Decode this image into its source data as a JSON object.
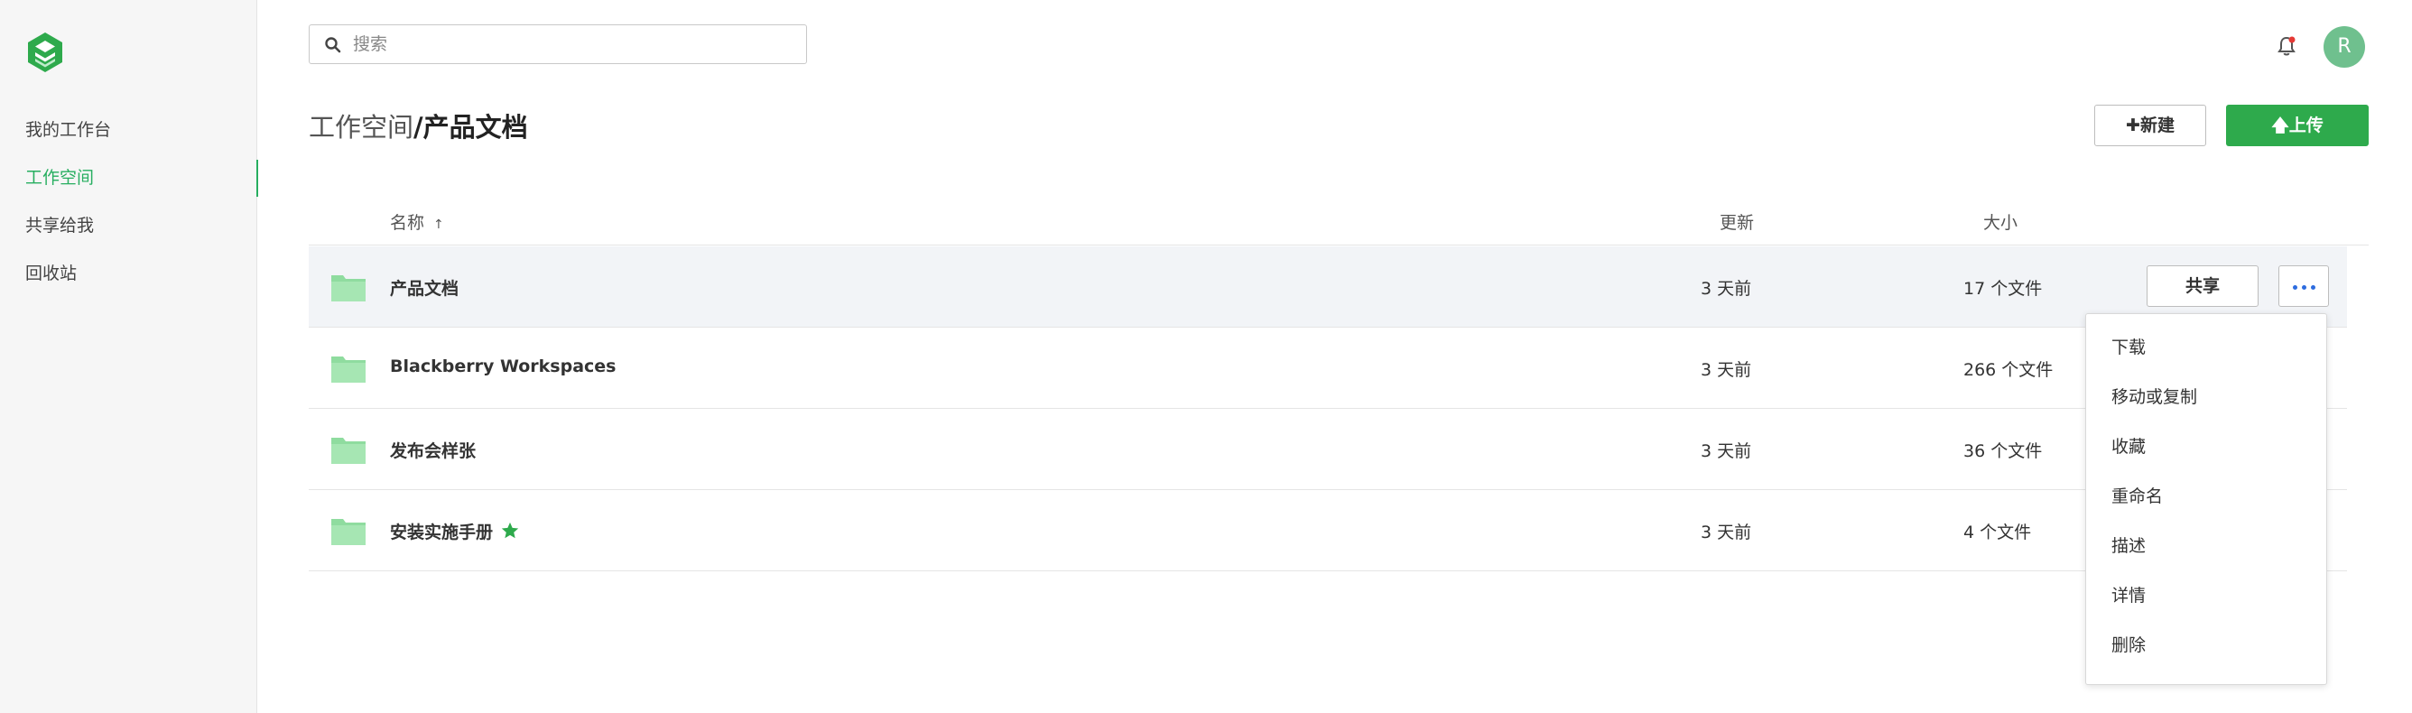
{
  "sidebar": {
    "items": [
      {
        "label": "我的工作台"
      },
      {
        "label": "工作空间"
      },
      {
        "label": "共享给我"
      },
      {
        "label": "回收站"
      }
    ]
  },
  "header": {
    "search_placeholder": "搜索",
    "avatar_initial": "R"
  },
  "page": {
    "breadcrumb_parent": "工作空间",
    "breadcrumb_sep": "/",
    "breadcrumb_current": "产品文档",
    "new_label": "新建",
    "upload_label": "上传"
  },
  "table": {
    "columns": {
      "name": "名称",
      "updated": "更新",
      "size": "大小"
    },
    "rows": [
      {
        "name": "产品文档",
        "updated": "3 天前",
        "size": "17 个文件"
      },
      {
        "name": "Blackberry Workspaces",
        "updated": "3 天前",
        "size": "266 个文件"
      },
      {
        "name": "发布会样张",
        "updated": "3 天前",
        "size": "36 个文件"
      },
      {
        "name": "安装实施手册",
        "updated": "3 天前",
        "size": "4 个文件",
        "starred": true
      }
    ],
    "share_label": "共享"
  },
  "menu": {
    "items": [
      {
        "label": "下载"
      },
      {
        "label": "移动或复制"
      },
      {
        "label": "收藏"
      },
      {
        "label": "重命名"
      },
      {
        "label": "描述"
      },
      {
        "label": "详情"
      },
      {
        "label": "删除"
      }
    ]
  },
  "colors": {
    "accent": "#27ae60",
    "upload_button": "#2eaa4c",
    "avatar": "#6fc08e",
    "folder": "#8fdc9f",
    "more_dots": "#2d6cdf",
    "bell_badge": "#e53935"
  },
  "icons": {
    "logo": "app-logo-icon",
    "search": "search-icon",
    "bell": "bell-icon",
    "folder": "folder-icon",
    "star": "star-icon",
    "more": "more-dots-icon",
    "sort": "sort-up-arrow-icon"
  }
}
